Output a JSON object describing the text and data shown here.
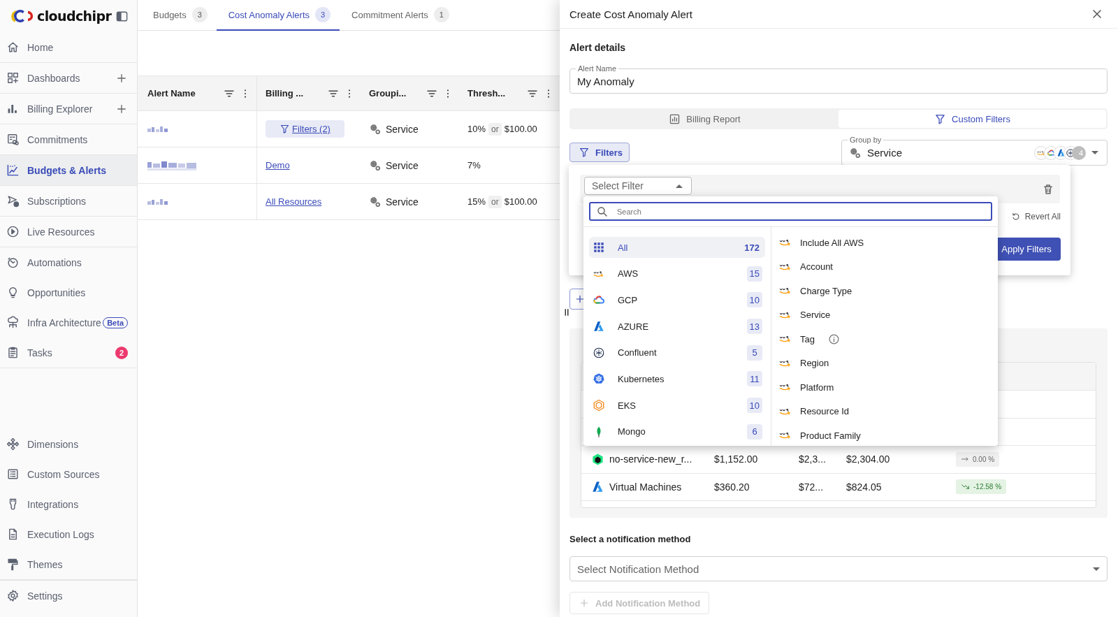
{
  "sidebar": {
    "logo_text": "cloudchipr",
    "groups": [
      {
        "items": [
          {
            "label": "Home",
            "selected": false,
            "add_button": false
          }
        ]
      },
      {
        "items": [
          {
            "label": "Dashboards",
            "selected": false,
            "add_button": true
          }
        ]
      },
      {
        "items": [
          {
            "label": "Billing Explorer",
            "selected": false,
            "add_button": true
          }
        ]
      },
      {
        "items": [
          {
            "label": "Commitments",
            "selected": false,
            "add_button": false
          }
        ]
      },
      {
        "items": [
          {
            "label": "Budgets & Alerts",
            "selected": true,
            "add_button": false
          }
        ]
      },
      {
        "items": [
          {
            "label": "Subscriptions",
            "selected": false,
            "add_button": false
          }
        ]
      },
      {
        "items": [
          {
            "label": "Live Resources",
            "selected": false,
            "add_button": false
          }
        ]
      },
      {
        "items": [
          {
            "label": "Automations",
            "selected": false,
            "add_button": false
          },
          {
            "label": "Opportunities",
            "selected": false,
            "add_button": false
          },
          {
            "label": "Infra Architecture",
            "selected": false,
            "add_button": false,
            "badge": {
              "kind": "tag",
              "text": "Beta"
            }
          },
          {
            "label": "Tasks",
            "selected": false,
            "add_button": false,
            "badge": {
              "kind": "count",
              "text": "2"
            }
          }
        ]
      }
    ],
    "bottom_groups": [
      {
        "items": [
          {
            "label": "Dimensions",
            "selected": false,
            "add_button": false
          },
          {
            "label": "Custom Sources",
            "selected": false,
            "add_button": false
          },
          {
            "label": "Integrations",
            "selected": false,
            "add_button": false
          },
          {
            "label": "Execution Logs",
            "selected": false,
            "add_button": false
          },
          {
            "label": "Themes",
            "selected": false,
            "add_button": false
          }
        ]
      },
      {
        "items": [
          {
            "label": "Settings",
            "selected": false,
            "add_button": false
          }
        ]
      }
    ]
  },
  "tabs": [
    {
      "label": "Budgets",
      "count": "3",
      "selected": false
    },
    {
      "label": "Cost Anomaly Alerts",
      "count": "3",
      "selected": true
    },
    {
      "label": "Commitment Alerts",
      "count": "1",
      "selected": false
    }
  ],
  "table": {
    "columns": [
      {
        "label": "Alert Name"
      },
      {
        "label": "Billing ..."
      },
      {
        "label": "Groupi..."
      },
      {
        "label": "Thresh..."
      }
    ],
    "rows": [
      {
        "name_redacted": true,
        "billing": {
          "kind": "chip",
          "text": "Filters (2)"
        },
        "grouping": "Service",
        "threshold": {
          "percent": "10%",
          "joiner": "or",
          "amount": "$100.00"
        }
      },
      {
        "name_redacted": true,
        "billing": {
          "kind": "link",
          "text": "Demo"
        },
        "grouping": "Service",
        "threshold": {
          "percent": "7%"
        }
      },
      {
        "name_redacted": true,
        "billing": {
          "kind": "link",
          "text": "All Resources"
        },
        "grouping": "Service",
        "threshold": {
          "percent": "15%",
          "joiner": "or",
          "amount": "$100.00"
        }
      }
    ]
  },
  "drawer": {
    "title": "Create Cost Anomaly Alert",
    "section_title": "Alert details",
    "alert_name": {
      "label": "Alert Name",
      "value": "My Anomaly"
    },
    "source_tabs": [
      {
        "label": "Billing Report",
        "selected": false
      },
      {
        "label": "Custom Filters",
        "selected": true
      }
    ],
    "filters_button": "Filters",
    "group_by": {
      "label": "Group by",
      "value": "Service",
      "more_count": "4"
    },
    "filter_panel": {
      "select": {
        "placeholder": "Select Filter",
        "expanded": true
      },
      "revert": "Revert All",
      "apply": "Apply Filters"
    },
    "filter_menu": {
      "search": {
        "placeholder": "Search"
      },
      "categories": [
        {
          "label": "All",
          "count": "172",
          "selected": true
        },
        {
          "label": "AWS",
          "count": "15",
          "selected": false
        },
        {
          "label": "GCP",
          "count": "10",
          "selected": false
        },
        {
          "label": "AZURE",
          "count": "13",
          "selected": false
        },
        {
          "label": "Confluent",
          "count": "5",
          "selected": false
        },
        {
          "label": "Kubernetes",
          "count": "11",
          "selected": false
        },
        {
          "label": "EKS",
          "count": "10",
          "selected": false
        },
        {
          "label": "Mongo",
          "count": "6",
          "selected": false
        }
      ],
      "options": [
        {
          "label": "Include All AWS",
          "info": false
        },
        {
          "label": "Account",
          "info": false
        },
        {
          "label": "Charge Type",
          "info": false
        },
        {
          "label": "Service",
          "info": false
        },
        {
          "label": "Tag",
          "info": true
        },
        {
          "label": "Region",
          "info": false
        },
        {
          "label": "Platform",
          "info": false
        },
        {
          "label": "Resource Id",
          "info": false
        },
        {
          "label": "Product Family",
          "info": false
        }
      ]
    },
    "preview": {
      "rows": [
        {
          "name": "no-service-new_r...",
          "col_2": "$1,152.00",
          "col_3": "$2,3...",
          "col_4": "$2,304.00",
          "trend": {
            "kind": "flat",
            "text": "0.00 %"
          }
        },
        {
          "name": "Virtual Machines",
          "col_2": "$360.20",
          "col_3": "$72...",
          "col_4": "$824.05",
          "trend": {
            "kind": "down",
            "text": "-12.58 %"
          }
        }
      ]
    },
    "notification": {
      "title": "Select a notification method",
      "select": {
        "placeholder": "Select Notification Method"
      },
      "add_button": {
        "label": "Add Notification Method",
        "disabled": true
      }
    }
  }
}
